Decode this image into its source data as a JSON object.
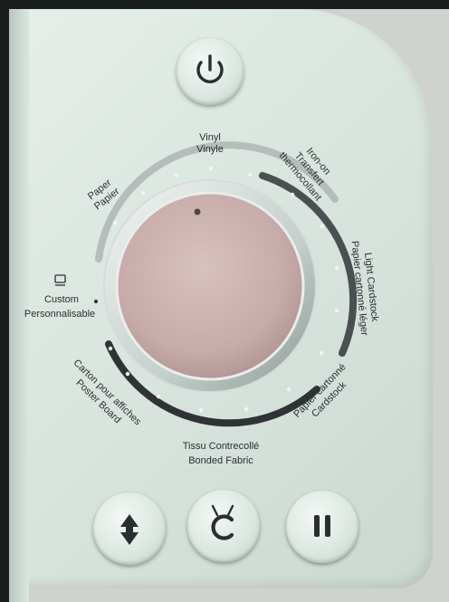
{
  "dial": {
    "labels": {
      "vinyl": [
        "Vinyl",
        "Vinyle"
      ],
      "paper": [
        "Paper",
        "Papier"
      ],
      "iron_on": [
        "Iron-on",
        "Transfert",
        "thermocollant"
      ],
      "light_cardstock": [
        "Light Cardstock",
        "Papier cartonné léger"
      ],
      "custom": [
        "Custom",
        "Personnalisable"
      ],
      "poster_board": [
        "Carton pour affiches",
        "Poster Board"
      ],
      "bonded_fabric": [
        "Tissu Contrecollé",
        "Bonded Fabric"
      ],
      "cardstock": [
        "Papier cartonné",
        "Cardstock"
      ]
    }
  },
  "buttons": {
    "power": {
      "icon": "power-icon"
    },
    "load_unload": {
      "icon": "updown-arrow-icon"
    },
    "go": {
      "icon": "cricut-c-icon"
    },
    "pause": {
      "icon": "pause-icon"
    }
  },
  "colors": {
    "panel": "#d7e3dc",
    "dial": "#c8aca9",
    "ring_dark": "#3b3f41",
    "ring_light": "#b9c2c0"
  }
}
